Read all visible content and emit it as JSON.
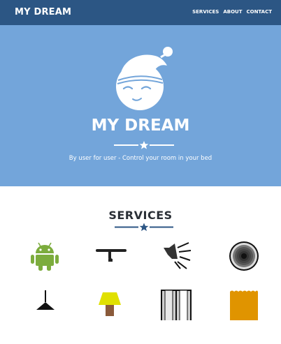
{
  "navbar": {
    "brand": "MY DREAM",
    "links": [
      "SERVICES",
      "ABOUT",
      "CONTACT"
    ]
  },
  "hero": {
    "title": "MY DREAM",
    "tagline": "By user for user - Control your room in your bed"
  },
  "services": {
    "title": "SERVICES",
    "items": [
      "android-icon",
      "pipe-valve-icon",
      "speaker-icon",
      "circular-disc-icon",
      "pendant-lamp-icon",
      "table-lamp-icon",
      "window-icon",
      "curtain-icon"
    ]
  },
  "colors": {
    "navbar": "#2c5684",
    "hero": "#73a5da",
    "accent": "#2c5684",
    "android": "#7cac3d",
    "lamp_shade": "#e0e000",
    "curtain": "#e09400"
  }
}
